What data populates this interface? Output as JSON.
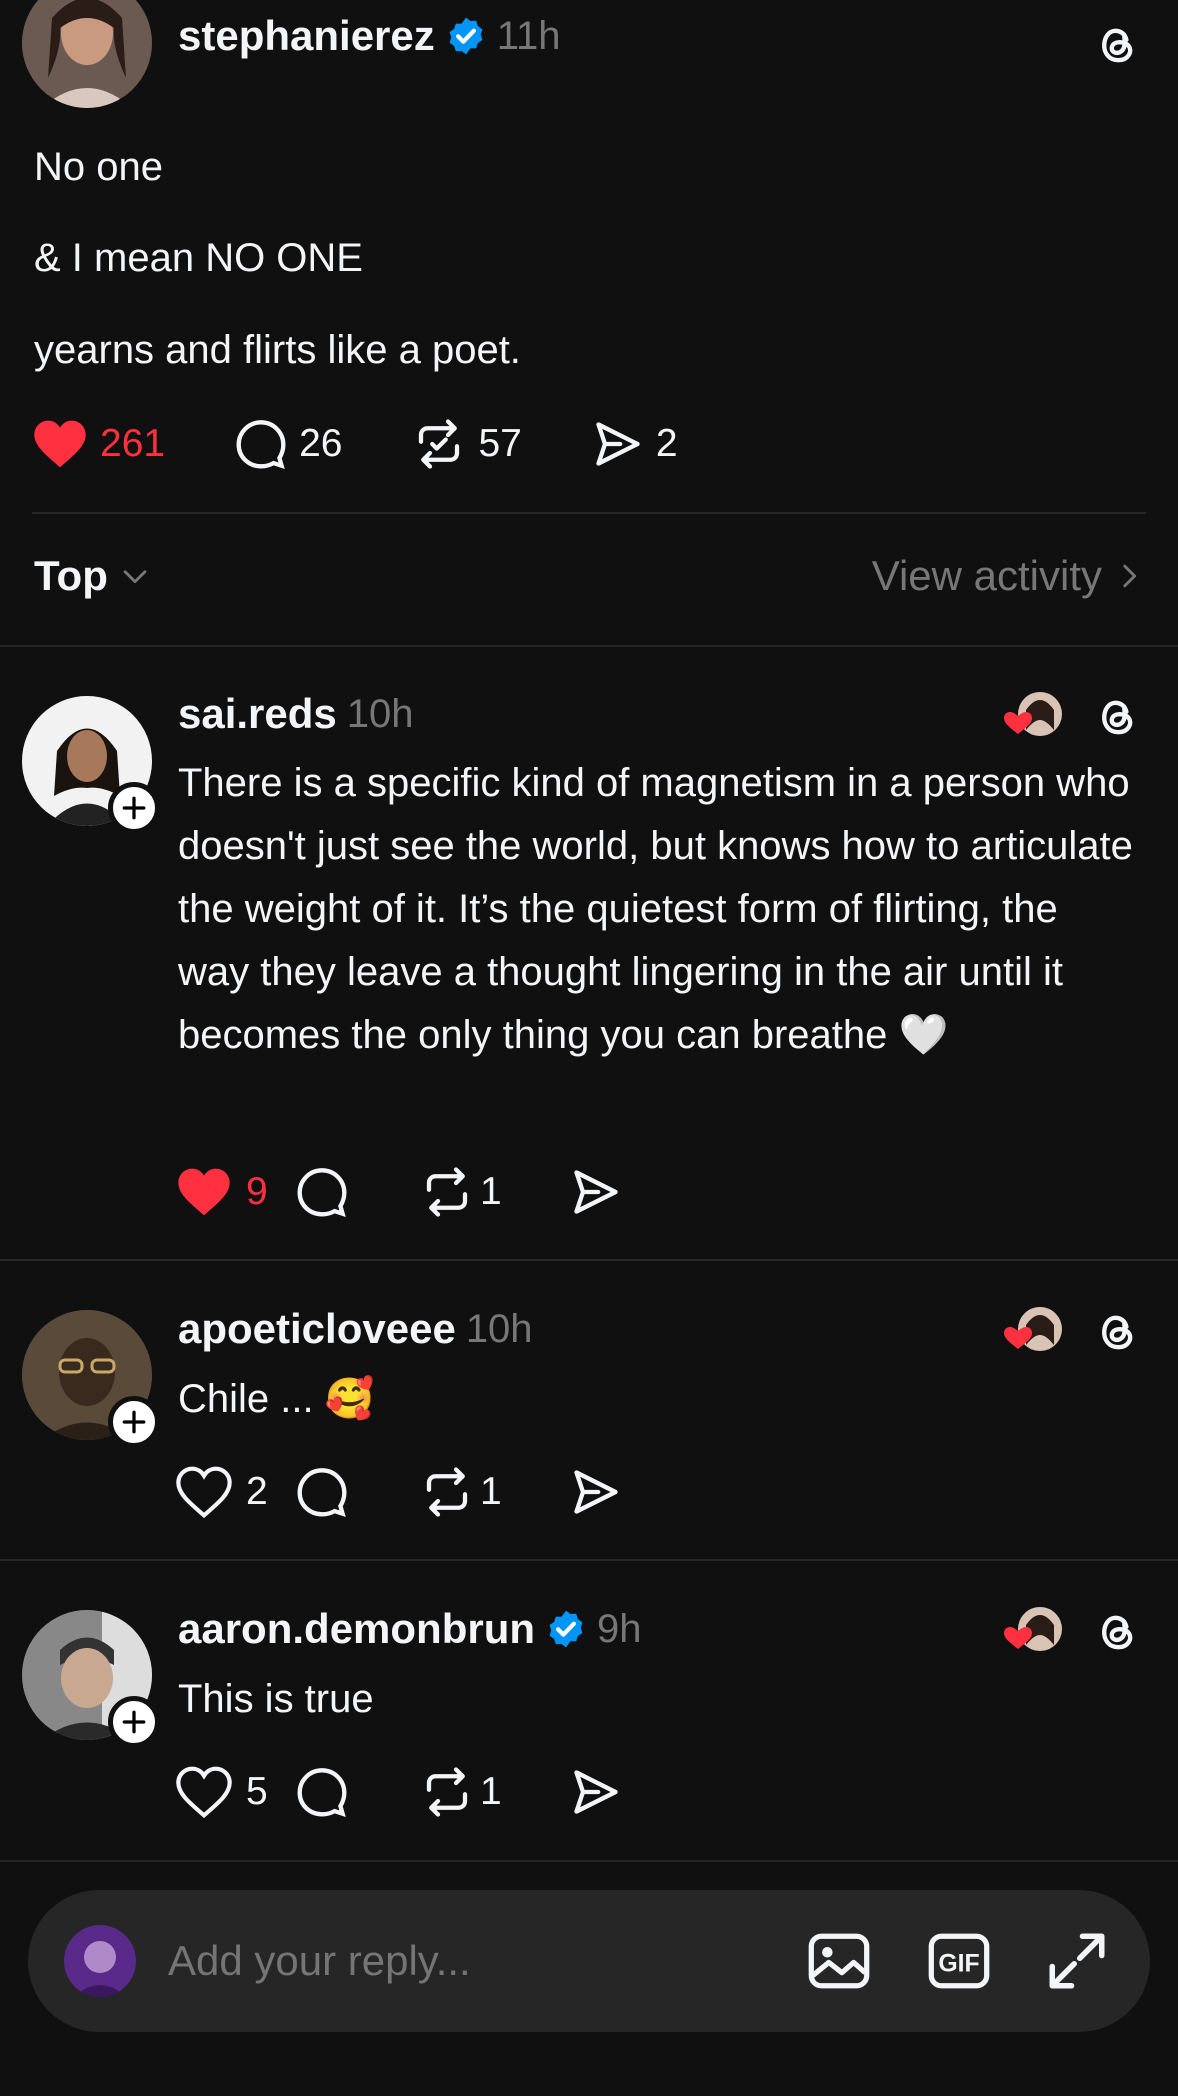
{
  "post": {
    "username": "stephanierez",
    "time": "11h",
    "lines": [
      "No one",
      "& I mean NO ONE",
      "yearns and flirts like a poet."
    ],
    "likes": "261",
    "comments": "26",
    "reposts": "57",
    "shares": "2"
  },
  "sort": {
    "label": "Top",
    "view_activity": "View activity"
  },
  "replies": [
    {
      "username": "sai.reds",
      "time": "10h",
      "text": "There is a specific kind of magnetism in a person who doesn't just see the world, but knows how to articulate the weight of it. It’s the quietest form of flirting, the way they leave a thought lingering in the air until it becomes the only thing you can breathe 🤍",
      "likes": "9",
      "reposts": "1",
      "verified": false,
      "liked": true
    },
    {
      "username": "apoeticloveee",
      "time": "10h",
      "text": "Chile ... 🥰",
      "likes": "2",
      "reposts": "1",
      "verified": false,
      "liked": false
    },
    {
      "username": "aaron.demonbrun",
      "time": "9h",
      "text": "This is true",
      "likes": "5",
      "reposts": "1",
      "verified": true,
      "liked": false
    }
  ],
  "composer": {
    "placeholder": "Add your reply..."
  },
  "colors": {
    "background": "#101010",
    "like_red": "#ff3040",
    "verified_blue": "#0095f6",
    "muted": "#777777"
  },
  "icons": [
    "verified-badge-icon",
    "threads-logo-icon",
    "heart-icon",
    "comment-icon",
    "repost-icon",
    "share-icon",
    "chevron-down-icon",
    "chevron-right-icon",
    "plus-icon",
    "image-icon",
    "gif-icon",
    "expand-icon"
  ]
}
